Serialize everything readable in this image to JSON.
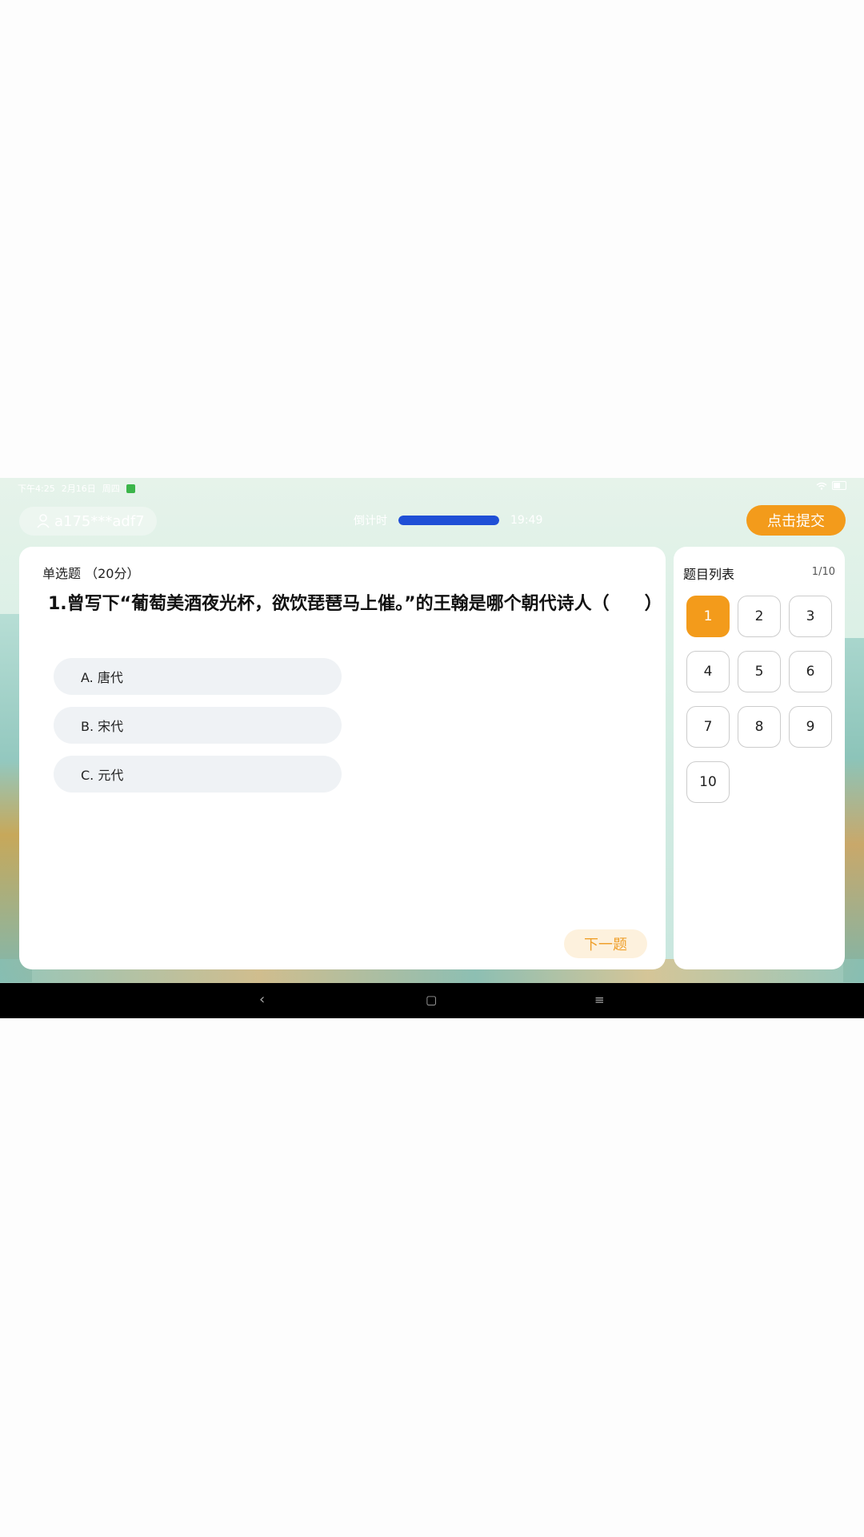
{
  "status": {
    "time": "下午4:25",
    "date": "2月16日",
    "weekday": "周四"
  },
  "header": {
    "user_id": "a175***adf7",
    "timer_label": "倒计时",
    "timer_value": "19:49",
    "progress_fraction": 1.0,
    "submit_label": "点击提交"
  },
  "question": {
    "type_label": "单选题",
    "score": "（20分）",
    "text": "1.曾写下“葡萄美酒夜光杯，欲饮琵琶马上催。”的王翰是哪个朝代诗人（　　）",
    "options": [
      {
        "label": "A. 唐代"
      },
      {
        "label": "B. 宋代"
      },
      {
        "label": "C. 元代"
      }
    ],
    "next_label": "下一题"
  },
  "question_list": {
    "title": "题目列表",
    "count": "1/10",
    "items": [
      "1",
      "2",
      "3",
      "4",
      "5",
      "6",
      "7",
      "8",
      "9",
      "10"
    ],
    "active_index": 0
  },
  "colors": {
    "accent": "#f39b1b",
    "progress": "#1f4fd6"
  }
}
